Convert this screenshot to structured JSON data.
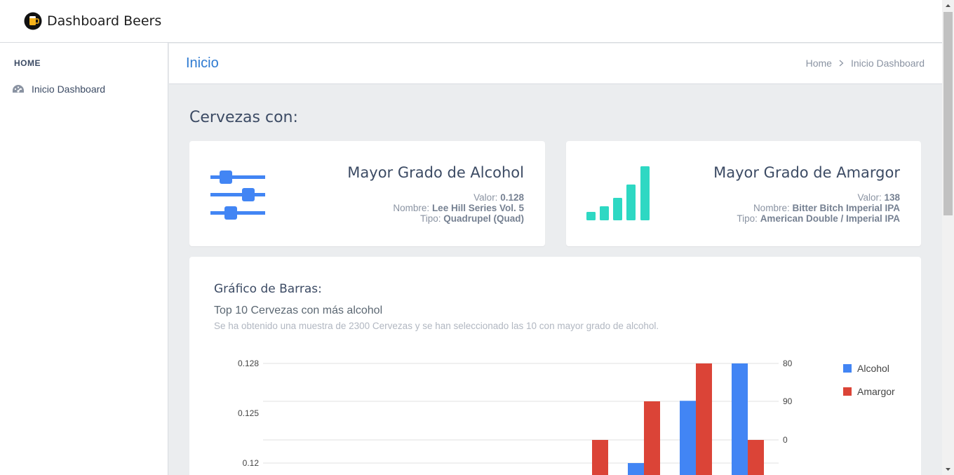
{
  "app": {
    "brand": "Dashboard Beers"
  },
  "sidebar": {
    "section_title": "HOME",
    "items": [
      {
        "label": "Inicio Dashboard",
        "icon": "speedometer-icon"
      }
    ]
  },
  "header": {
    "title": "Inicio",
    "breadcrumb": [
      "Home",
      "Inicio Dashboard"
    ]
  },
  "main": {
    "section_title": "Cervezas con:",
    "cards": [
      {
        "heading": "Mayor Grado de Alcohol",
        "icon": "sliders-icon",
        "color": "#4285f4",
        "lines": [
          {
            "label": "Valor:",
            "value": "0.128"
          },
          {
            "label": "Nombre:",
            "value": "Lee Hill Series Vol. 5"
          },
          {
            "label": "Tipo:",
            "value": "Quadrupel (Quad)"
          }
        ]
      },
      {
        "heading": "Mayor Grado de Amargor",
        "icon": "signal-bars-icon",
        "color": "#2ed8c3",
        "lines": [
          {
            "label": "Valor:",
            "value": "138"
          },
          {
            "label": "Nombre:",
            "value": "Bitter Bitch Imperial IPA"
          },
          {
            "label": "Tipo:",
            "value": "American Double / Imperial IPA"
          }
        ]
      }
    ],
    "chart_card": {
      "title": "Gráfico de Barras:",
      "subtitle": "Top 10 Cervezas con más alcohol",
      "description": "Se ha obtenido una muestra de 2300 Cervezas y se han seleccionado las 10 con mayor grado de alcohol."
    }
  },
  "chart_data": {
    "type": "bar",
    "left_axis_ticks": [
      "0.128",
      "0.125",
      "0.12"
    ],
    "right_axis_ticks": [
      "80",
      "90",
      "0"
    ],
    "legend_position": "right",
    "series": [
      {
        "name": "Alcohol",
        "color": "#4285f4",
        "values": [
          null,
          null,
          null,
          null,
          null,
          null,
          null,
          0.12,
          0.125,
          0.128
        ]
      },
      {
        "name": "Amargor",
        "color": "#db4437",
        "values": [
          null,
          null,
          null,
          null,
          null,
          null,
          0,
          90,
          80,
          0
        ]
      }
    ]
  }
}
